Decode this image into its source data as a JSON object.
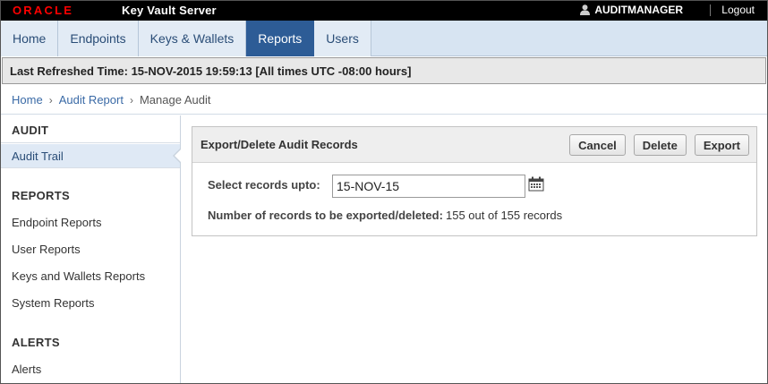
{
  "header": {
    "brand_logo": "ORACLE",
    "product_name": "Key Vault Server",
    "user_name": "AUDITMANAGER",
    "logout_label": "Logout"
  },
  "tabs": [
    {
      "label": "Home",
      "active": false
    },
    {
      "label": "Endpoints",
      "active": false
    },
    {
      "label": "Keys & Wallets",
      "active": false
    },
    {
      "label": "Reports",
      "active": true
    },
    {
      "label": "Users",
      "active": false
    }
  ],
  "refresh_text": "Last Refreshed Time: 15-NOV-2015 19:59:13 [All times UTC -08:00 hours]",
  "breadcrumb": {
    "items": [
      "Home",
      "Audit Report"
    ],
    "current": "Manage Audit"
  },
  "sidebar": {
    "sections": [
      {
        "heading": "AUDIT",
        "items": [
          "Audit Trail"
        ]
      },
      {
        "heading": "REPORTS",
        "items": [
          "Endpoint Reports",
          "User Reports",
          "Keys and Wallets Reports",
          "System Reports"
        ]
      },
      {
        "heading": "ALERTS",
        "items": [
          "Alerts"
        ]
      }
    ],
    "active_item": "Audit Trail"
  },
  "panel": {
    "title": "Export/Delete Audit Records",
    "buttons": {
      "cancel": "Cancel",
      "delete": "Delete",
      "export": "Export"
    },
    "select_label": "Select records upto:",
    "date_value": "15-NOV-15",
    "count_label": "Number of records to be exported/deleted:",
    "count_value": "155 out of 155 records"
  },
  "colors": {
    "active_tab": "#2d5c96",
    "link": "#3a6aa6",
    "topbar": "#000000",
    "logo_red": "#ff0000"
  },
  "icons": [
    "user-icon",
    "calendar-icon",
    "chevron-right-icon"
  ]
}
